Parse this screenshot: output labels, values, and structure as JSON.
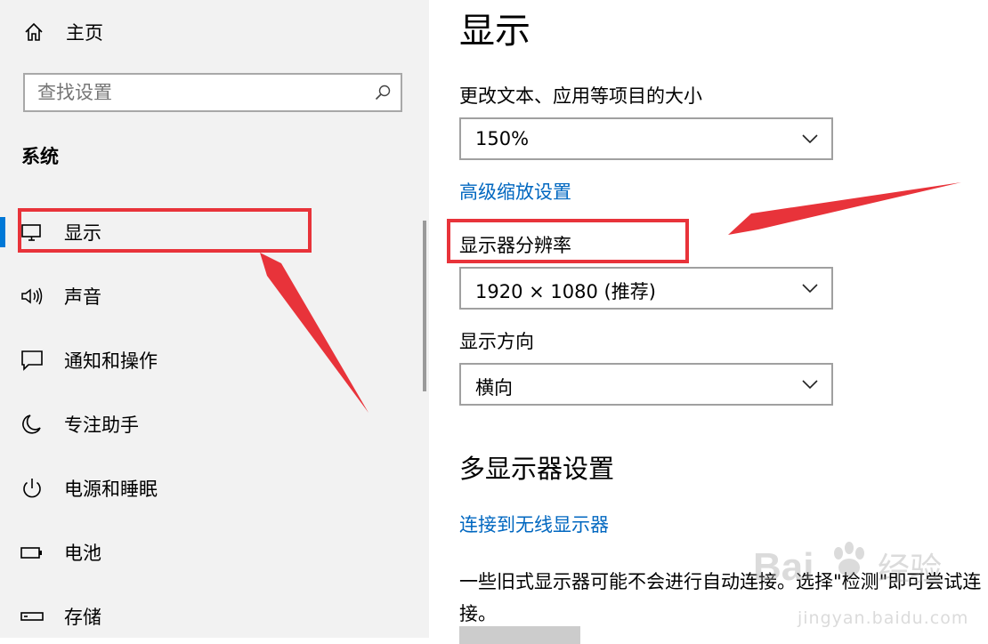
{
  "nav": {
    "home_label": "主页",
    "search_placeholder": "查找设置",
    "section_title": "系统",
    "items": [
      {
        "label": "显示",
        "icon": "monitor-icon",
        "active": true
      },
      {
        "label": "声音",
        "icon": "speaker-icon"
      },
      {
        "label": "通知和操作",
        "icon": "notification-icon"
      },
      {
        "label": "专注助手",
        "icon": "moon-icon"
      },
      {
        "label": "电源和睡眠",
        "icon": "power-icon"
      },
      {
        "label": "电池",
        "icon": "battery-icon"
      },
      {
        "label": "存储",
        "icon": "storage-icon"
      }
    ]
  },
  "main": {
    "title": "显示",
    "scale_label": "更改文本、应用等项目的大小",
    "scale_value": "150%",
    "advanced_scaling_link": "高级缩放设置",
    "resolution_label": "显示器分辨率",
    "resolution_value": "1920 × 1080 (推荐)",
    "orientation_label": "显示方向",
    "orientation_value": "横向",
    "multi_display_heading": "多显示器设置",
    "wireless_link": "连接到无线显示器",
    "description": "一些旧式显示器可能不会进行自动连接。选择\"检测\"即可尝试连接。"
  },
  "watermark": {
    "brand": "Bai",
    "brand_suffix": "经验",
    "url": "jingyan.baidu.com"
  },
  "colors": {
    "accent": "#0078d7",
    "link": "#0067c0",
    "annotation_red": "#e8333a",
    "nav_background": "#f2f2f2"
  }
}
